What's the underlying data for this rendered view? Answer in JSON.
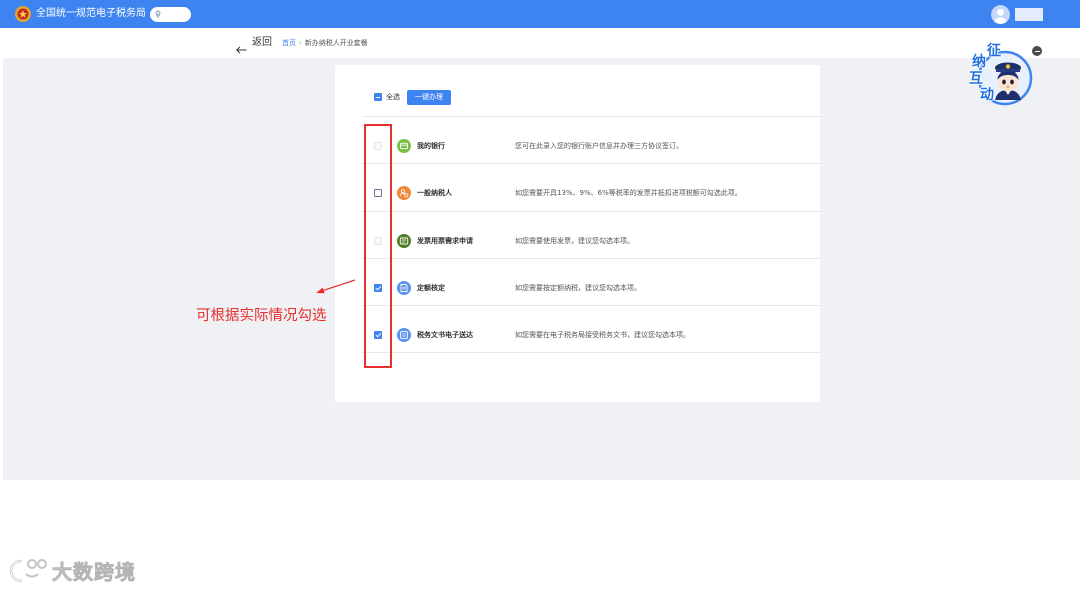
{
  "theme": {
    "accent": "#3e84f0",
    "background": "#f0f1f5"
  },
  "header": {
    "title": "全国统一规范电子税务局",
    "emblem_icon": "tax-emblem-icon",
    "location_icon": "location-pin-icon",
    "avatar_icon": "user-avatar-icon"
  },
  "nav": {
    "back_icon": "arrow-left-icon",
    "back_label": "返回",
    "breadcrumb": {
      "home": "首页",
      "separator": "›",
      "current": "新办纳税人开业套餐"
    }
  },
  "toolbar": {
    "select_all": {
      "label": "全选",
      "state": "indeterminate"
    },
    "one_click_button": "一键办理"
  },
  "items": [
    {
      "title": "我的银行",
      "description": "您可在此录入您的银行账户信息并办理三方协议签订。",
      "checkbox": "disabled",
      "icon": "bank-card-icon",
      "icon_color": "#7ac143"
    },
    {
      "title": "一般纳税人",
      "description": "如您需要开具13%、9%、6%等税率的发票并抵扣进项税额可勾选此项。",
      "checkbox": "unchecked",
      "icon": "taxpayer-icon",
      "icon_color": "#f0883a"
    },
    {
      "title": "发票用票需求申请",
      "description": "如您需要使用发票，建议您勾选本项。",
      "checkbox": "disabled",
      "icon": "invoice-icon",
      "icon_color": "#4e7d22"
    },
    {
      "title": "定额核定",
      "description": "如您需要按定额纳税，建议您勾选本项。",
      "checkbox": "checked",
      "icon": "quota-document-icon",
      "icon_color": "#5b93ee"
    },
    {
      "title": "税务文书电子送达",
      "description": "如您需要在电子税务局接受税务文书，建议您勾选本项。",
      "checkbox": "checked",
      "icon": "e-delivery-document-icon",
      "icon_color": "#5b93ee"
    }
  ],
  "annotation": {
    "text": "可根据实际情况勾选",
    "color": "#e8302e"
  },
  "assistant_widget": {
    "chars": [
      "征",
      "纳",
      "互",
      "动"
    ],
    "mascot_icon": "tax-officer-mascot-icon",
    "close_icon": "minus-circle-icon"
  },
  "watermark": {
    "text": "大数跨境",
    "logo_icon": "watermark-logo-icon"
  }
}
